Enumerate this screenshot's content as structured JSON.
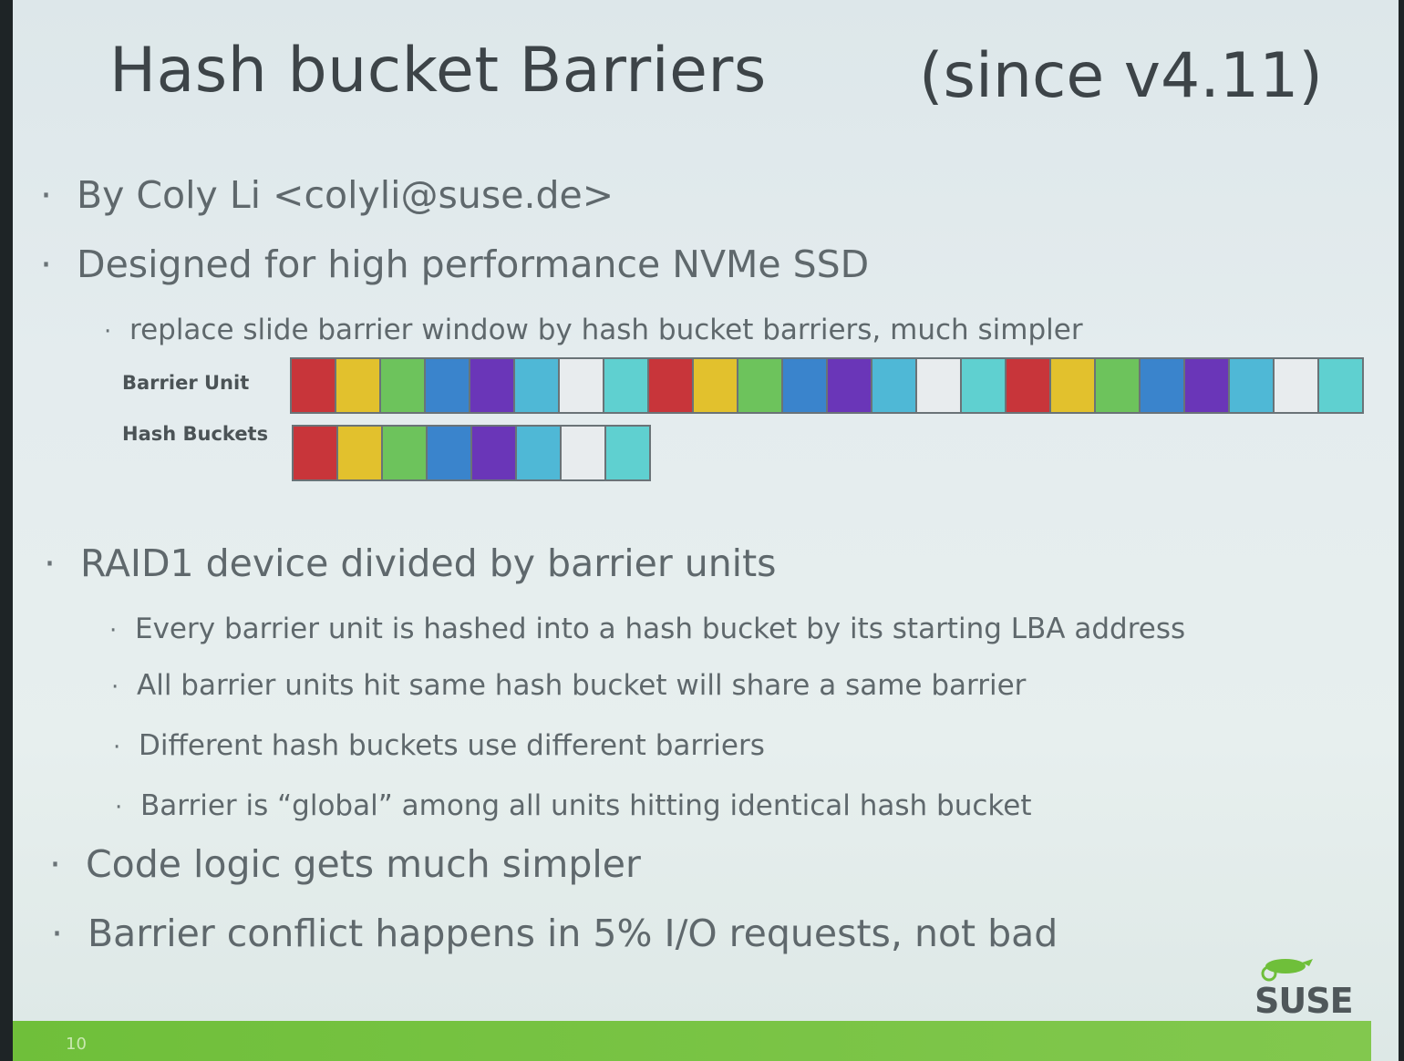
{
  "slide": {
    "title": "Hash bucket Barriers",
    "since": "(since v4.11)",
    "bullets": [
      {
        "text": "By Coly Li <colyli@suse.de>"
      },
      {
        "text": "Designed for high performance NVMe SSD"
      },
      {
        "text": "replace slide barrier window by hash bucket barriers, much simpler"
      },
      {
        "text": "RAID1 device divided by barrier units"
      },
      {
        "text": "Every barrier unit is hashed into a hash bucket by its starting LBA address"
      },
      {
        "text": "All barrier units hit same hash bucket will share a same barrier"
      },
      {
        "text": "Different hash buckets use different barriers"
      },
      {
        "text": "Barrier is “global” among all units hitting identical hash bucket"
      },
      {
        "text": "Code logic gets much simpler"
      },
      {
        "text": "Barrier conflict happens in 5% I/O requests, not bad"
      }
    ],
    "bullet_mark": "·",
    "diagram": {
      "barrier_label": "Barrier Unit",
      "hash_label": "Hash Buckets",
      "palette": [
        "#c8353a",
        "#e2c12d",
        "#6dc35c",
        "#3a84cc",
        "#6a36b8",
        "#4fb8d6",
        "#e8ecee",
        "#5fd0d0"
      ],
      "barrier_repeat": 3
    },
    "page_number": "10",
    "logo_text": "SUSE"
  }
}
